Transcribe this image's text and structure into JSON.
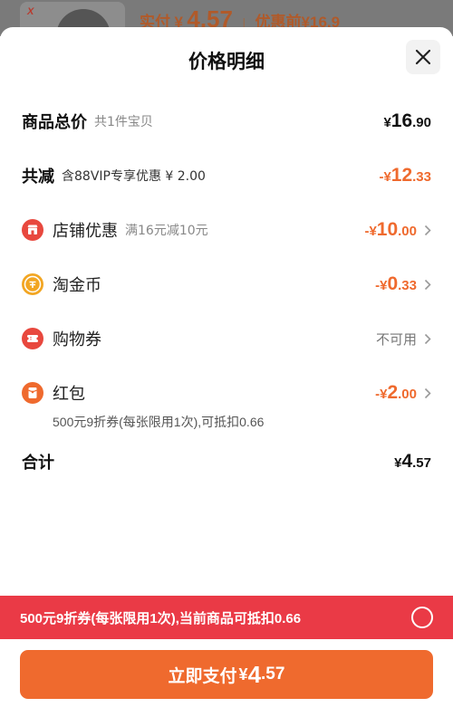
{
  "background_header": {
    "brand_logo": "X",
    "actual_pay_label": "实付",
    "currency": "¥",
    "actual_pay_value": "4.57",
    "separator": "|",
    "before_discount": "优惠前¥16.9"
  },
  "sheet": {
    "title": "价格明细",
    "close_icon": "close-icon"
  },
  "rows": {
    "total_price": {
      "label": "商品总价",
      "sub": "共1件宝贝",
      "currency": "¥",
      "int": "16",
      "dec": ".90"
    },
    "total_discount": {
      "label": "共减",
      "sub": "含88VIP专享优惠 ¥ 2.00",
      "prefix": "-",
      "currency": "¥",
      "int": "12",
      "dec": ".33"
    },
    "store_discount": {
      "label": "店铺优惠",
      "sub": "满16元减10元",
      "prefix": "-",
      "currency": "¥",
      "int": "10",
      "dec": ".00",
      "icon": "store-icon"
    },
    "taojin_coin": {
      "label": "淘金币",
      "prefix": "-",
      "currency": "¥",
      "int": "0",
      "dec": ".33",
      "icon": "coin-icon"
    },
    "shopping_voucher": {
      "label": "购物券",
      "status": "不可用",
      "icon": "voucher-icon"
    },
    "red_packet": {
      "label": "红包",
      "prefix": "-",
      "currency": "¥",
      "int": "2",
      "dec": ".00",
      "icon": "red-packet-icon",
      "note": "500元9折券(每张限用1次),可抵扣0.66"
    },
    "subtotal": {
      "label": "合计",
      "currency": "¥",
      "int": "4",
      "dec": ".57"
    }
  },
  "banner": {
    "text": "500元9折券(每张限用1次),当前商品可抵扣0.66"
  },
  "pay_button": {
    "label": "立即支付",
    "currency": "¥",
    "int": "4",
    "dec": ".57"
  },
  "colors": {
    "accent_orange": "#ef6a2e",
    "banner_red": "#ea3a46",
    "icon_red": "#e8483e",
    "icon_gold": "#f2a623"
  }
}
